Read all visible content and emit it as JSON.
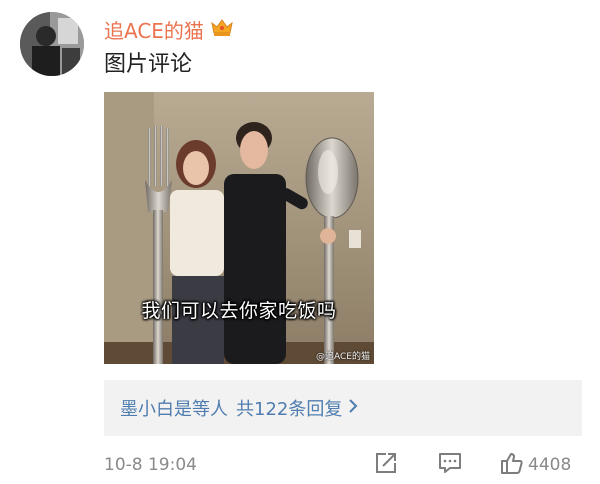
{
  "comment": {
    "username": "追ACE的猫",
    "text": "图片评论",
    "image": {
      "caption": "我们可以去你家吃饭吗",
      "watermark": "@追ACE的猫"
    },
    "reply": {
      "replier": "墨小白是等人",
      "count_text": "共122条回复"
    },
    "timestamp": "10-8 19:04",
    "likes": "4408"
  },
  "colors": {
    "username": "#eb7350",
    "link": "#507daf",
    "meta": "#8a8a8a",
    "reply_bg": "#f2f2f2",
    "crown": "#f5a623"
  },
  "icons": [
    "crown-icon",
    "share-icon",
    "comment-icon",
    "like-icon",
    "chevron-right-icon"
  ]
}
